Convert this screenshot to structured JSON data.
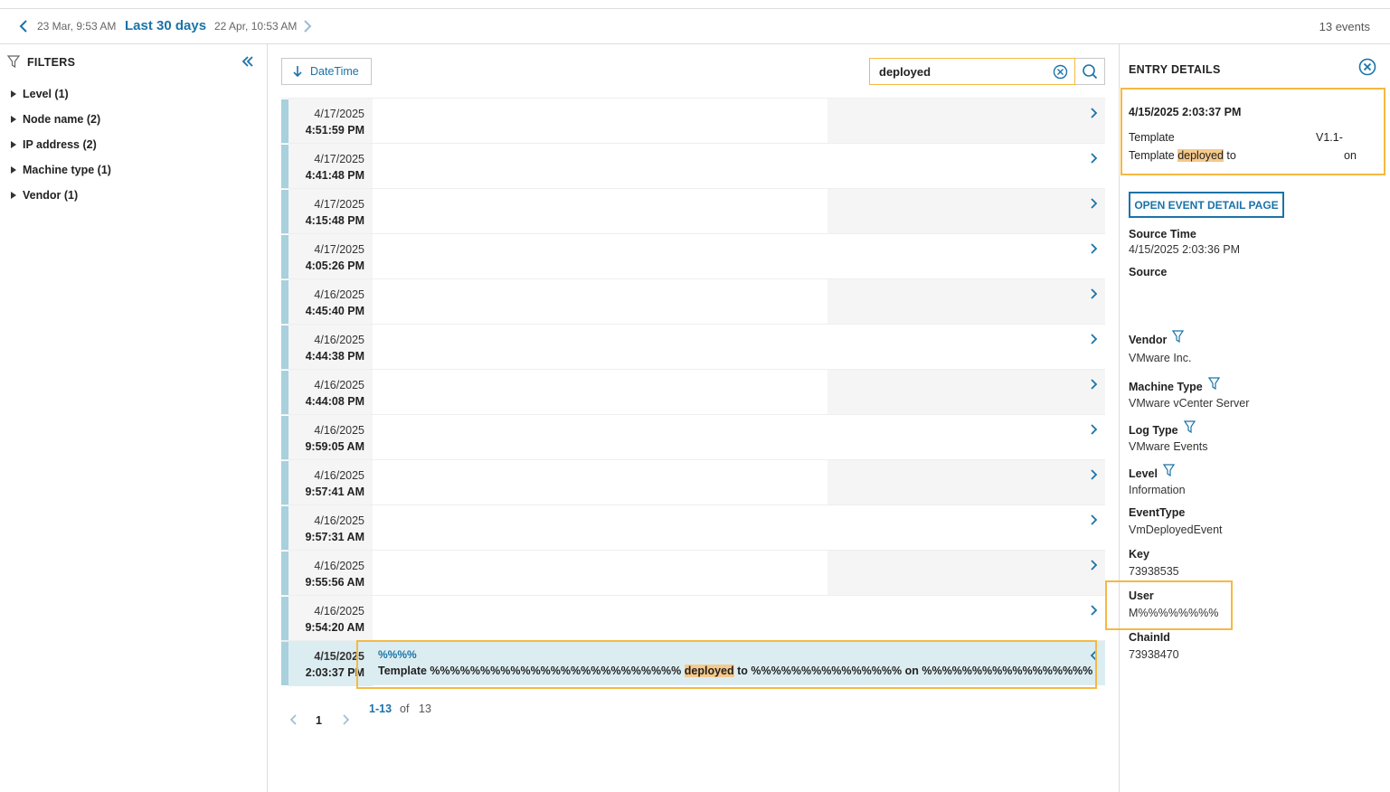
{
  "topbar": {
    "from": "23 Mar, 9:53 AM",
    "range": "Last 30 days",
    "to": "22 Apr, 10:53 AM",
    "count": "13 events",
    "prev_icon": "chevron-left-icon",
    "next_icon": "chevron-right-icon"
  },
  "filters": {
    "title": "FILTERS",
    "items": [
      {
        "label": "Level (1)"
      },
      {
        "label": "Node name (2)"
      },
      {
        "label": "IP address (2)"
      },
      {
        "label": "Machine type (1)"
      },
      {
        "label": "Vendor (1)"
      }
    ]
  },
  "toolbar": {
    "sort_label": "DateTime",
    "search_value": "deployed"
  },
  "rows": [
    {
      "date": "4/17/2025",
      "time": "4:51:59 PM"
    },
    {
      "date": "4/17/2025",
      "time": "4:41:48 PM"
    },
    {
      "date": "4/17/2025",
      "time": "4:15:48 PM"
    },
    {
      "date": "4/17/2025",
      "time": "4:05:26 PM"
    },
    {
      "date": "4/16/2025",
      "time": "4:45:40 PM"
    },
    {
      "date": "4/16/2025",
      "time": "4:44:38 PM"
    },
    {
      "date": "4/16/2025",
      "time": "4:44:08 PM"
    },
    {
      "date": "4/16/2025",
      "time": "9:59:05 AM"
    },
    {
      "date": "4/16/2025",
      "time": "9:57:41 AM"
    },
    {
      "date": "4/16/2025",
      "time": "9:57:31 AM"
    },
    {
      "date": "4/16/2025",
      "time": "9:55:56 AM"
    },
    {
      "date": "4/16/2025",
      "time": "9:54:20 AM"
    },
    {
      "date": "4/15/2025",
      "time": "2:03:37 PM"
    }
  ],
  "selected_row": {
    "tag": "%%%%",
    "msg_prefix": "Template ",
    "msg_obf1": "%%%%%%%%%%%%%%%%%%%%%%%%% ",
    "msg_hl": "deployed",
    "msg_mid": " to ",
    "msg_obf2": "%%%%%%%%%%%%%%% ",
    "msg_on": "on ",
    "msg_obf3": "%%%%%%%%%%%%%%%%%%%%%%%%%%%%%%%%"
  },
  "pager": {
    "page": "1",
    "range": "1-13",
    "of": "of",
    "total": "13"
  },
  "details": {
    "title": "ENTRY DETAILS",
    "timestamp": "4/15/2025 2:03:37 PM",
    "line1_a": "Template",
    "line1_b": "V1.1-",
    "line2_a": "Template ",
    "line2_hl": "deployed",
    "line2_c": " to",
    "line2_d": "on",
    "open_button": "OPEN EVENT DETAIL PAGE",
    "fields": [
      {
        "label": "Source Time",
        "value": "4/15/2025 2:03:36 PM",
        "filter": false
      },
      {
        "label": "Source",
        "value": "",
        "filter": false
      },
      {
        "label": "Vendor",
        "value": "VMware Inc.",
        "filter": true
      },
      {
        "label": "Machine Type",
        "value": "VMware vCenter Server",
        "filter": true
      },
      {
        "label": "Log Type",
        "value": "VMware Events",
        "filter": true
      },
      {
        "label": "Level",
        "value": "Information",
        "filter": true
      },
      {
        "label": "EventType",
        "value": "VmDeployedEvent",
        "filter": false
      },
      {
        "label": "Key",
        "value": "73938535",
        "filter": false
      },
      {
        "label": "User",
        "value": "M%%%%%%%%",
        "filter": false
      },
      {
        "label": "ChainId",
        "value": "73938470",
        "filter": false
      }
    ]
  },
  "colors": {
    "accent": "#1a73a8",
    "highlight": "#f5b942",
    "row_bar": "#a8d0dd",
    "selected_bg": "#dcedf2"
  }
}
